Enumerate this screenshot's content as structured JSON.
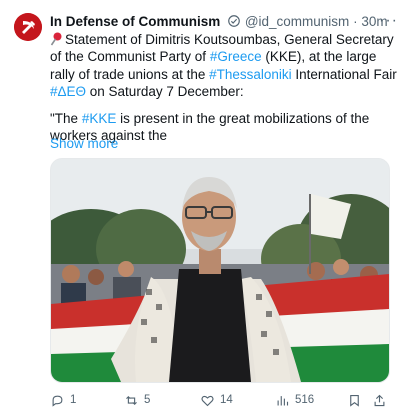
{
  "author": {
    "name": "In Defense of Communism",
    "handle": "@id_communism",
    "separator": "·",
    "time": "30m"
  },
  "tweet": {
    "line1_pre": "Statement of Dimitris Koutsoumbas, General Secretary of the Communist Party of ",
    "hashtag_greece": "#Greece",
    "line1_mid": " (KKE), at the large rally of trade unions at the ",
    "hashtag_thessaloniki": "#Thessaloniki",
    "line1_mid2": " International Fair ",
    "hashtag_deth": "#ΔΕΘ",
    "line1_post": " on Saturday 7 December:",
    "quote_pre": "\"The ",
    "hashtag_kke": "#KKE",
    "quote_post": " is present in the great mobilizations of the workers against the",
    "show_more": "Show more"
  },
  "actions": {
    "replies": "1",
    "reposts": "5",
    "likes": "14",
    "views": "516"
  },
  "colors": {
    "accent": "#1d9bf0",
    "text": "#0f1419",
    "muted": "#536471",
    "brand_red": "#c4161c"
  },
  "icons": [
    "hammer-sickle-avatar",
    "verified-icon",
    "more-icon",
    "pin-icon",
    "reply-icon",
    "repost-icon",
    "like-icon",
    "views-icon",
    "bookmark-icon",
    "share-icon"
  ]
}
